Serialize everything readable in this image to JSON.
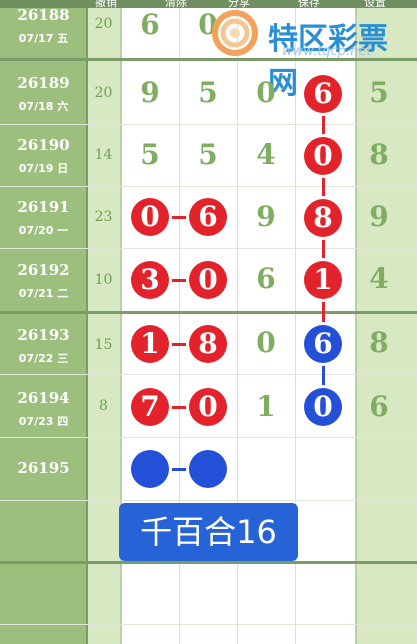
{
  "header": {
    "labels": [
      "撤销",
      "清除",
      "分享",
      "保存",
      "设置"
    ]
  },
  "watermark": {
    "text": "特区彩票网",
    "url": "www.tqcp.net"
  },
  "rows": [
    {
      "issue": "26188",
      "date": "07/17 五",
      "sum": "20",
      "digits": [
        "6",
        "0",
        "",
        ""
      ],
      "right": ""
    },
    {
      "issue": "26189",
      "date": "07/18 六",
      "sum": "20",
      "digits": [
        "9",
        "5",
        "0",
        "6"
      ],
      "right": "5"
    },
    {
      "issue": "26190",
      "date": "07/19 日",
      "sum": "14",
      "digits": [
        "5",
        "5",
        "4",
        "0"
      ],
      "right": "8"
    },
    {
      "issue": "26191",
      "date": "07/20 一",
      "sum": "23",
      "digits": [
        "0",
        "6",
        "9",
        "8"
      ],
      "right": "9"
    },
    {
      "issue": "26192",
      "date": "07/21 二",
      "sum": "10",
      "digits": [
        "3",
        "0",
        "6",
        "1"
      ],
      "right": "4"
    },
    {
      "issue": "26193",
      "date": "07/22 三",
      "sum": "15",
      "digits": [
        "1",
        "8",
        "0",
        "6"
      ],
      "right": "8"
    },
    {
      "issue": "26194",
      "date": "07/23 四",
      "sum": "8",
      "digits": [
        "7",
        "0",
        "1",
        "0"
      ],
      "right": "6"
    },
    {
      "issue": "26195",
      "date": "",
      "sum": "",
      "digits": [
        "",
        "",
        "",
        ""
      ],
      "right": ""
    }
  ],
  "badge": {
    "text": "千百合16"
  },
  "colors": {
    "red_ball": "#e3232b",
    "blue_ball": "#2450d8",
    "issue_bg": "#9dbf7e",
    "light_col": "#d7e8c3",
    "badge": "#2563d6"
  }
}
